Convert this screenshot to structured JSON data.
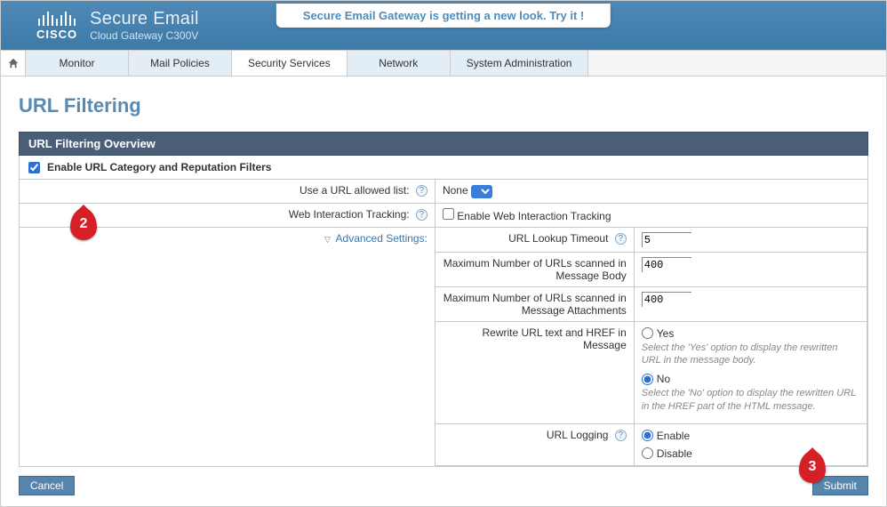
{
  "banner": "Secure Email Gateway is getting a new look. Try it !",
  "brand": {
    "product": "Secure Email",
    "model": "Cloud Gateway C300V",
    "logo_text": "CISCO"
  },
  "nav": {
    "items": [
      "Monitor",
      "Mail Policies",
      "Security Services",
      "Network",
      "System Administration"
    ],
    "active_index": 2
  },
  "page": {
    "title": "URL Filtering"
  },
  "overview": {
    "header": "URL Filtering Overview",
    "enable_label": "Enable URL Category and Reputation Filters",
    "enable_checked": true,
    "rows": {
      "allowed_list": {
        "label": "Use a URL allowed list:",
        "value": "None"
      },
      "web_tracking": {
        "label": "Web Interaction Tracking:",
        "checkbox_label": "Enable Web Interaction Tracking",
        "checked": false
      },
      "advanced_label": "Advanced Settings:"
    },
    "advanced": {
      "lookup_timeout": {
        "label": "URL Lookup Timeout",
        "value": "5"
      },
      "max_body": {
        "label": "Maximum Number of URLs scanned in Message Body",
        "value": "400"
      },
      "max_attach": {
        "label": "Maximum Number of URLs scanned in Message Attachments",
        "value": "400"
      },
      "rewrite": {
        "label": "Rewrite URL text and HREF in Message",
        "yes": "Yes",
        "yes_hint": "Select the 'Yes' option to display the rewritten URL in the message body.",
        "no": "No",
        "no_hint": "Select the 'No' option to display the rewritten URL in the HREF part of the HTML message.",
        "selected": "no"
      },
      "logging": {
        "label": "URL Logging",
        "enable": "Enable",
        "disable": "Disable",
        "selected": "enable"
      }
    }
  },
  "buttons": {
    "cancel": "Cancel",
    "submit": "Submit"
  },
  "callouts": {
    "c2": "2",
    "c3": "3"
  }
}
